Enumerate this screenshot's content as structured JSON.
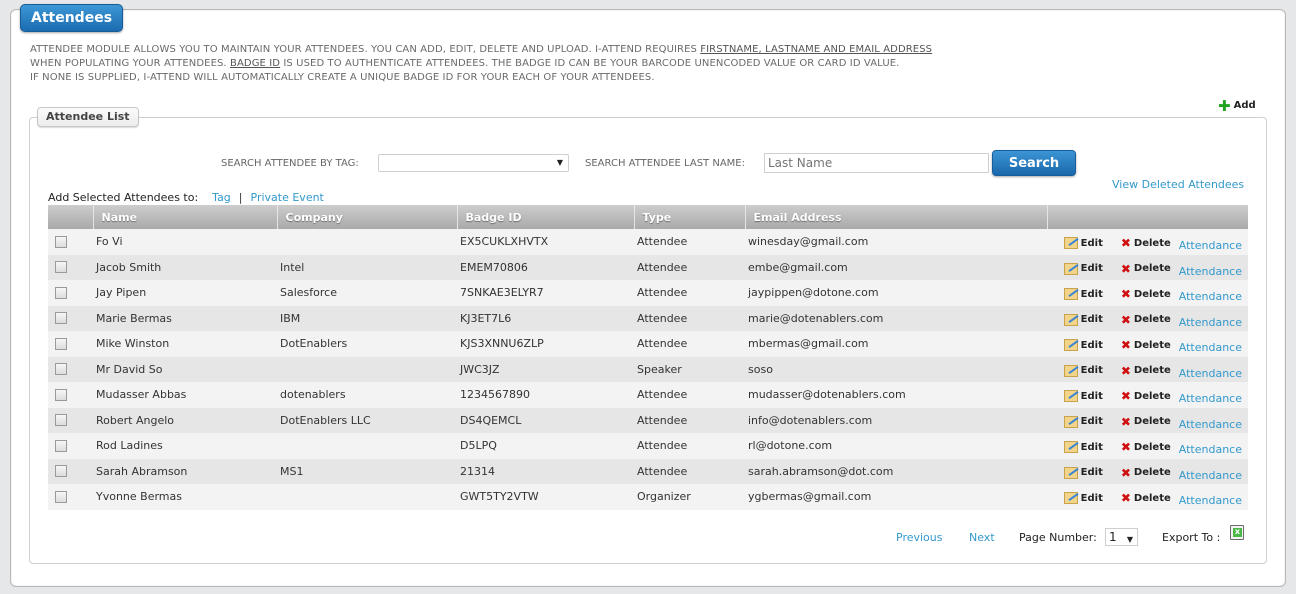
{
  "module": {
    "title": "Attendees",
    "intro_lines": [
      {
        "text": "ATTENDEE MODULE ALLOWS YOU TO MAINTAIN YOUR ATTENDEES. YOU CAN ADD, EDIT, DELETE AND UPLOAD. I-ATTEND REQUIRES ",
        "underlined": "FIRSTNAME, LASTNAME AND EMAIL ADDRESS",
        "after": ""
      },
      {
        "text": "WHEN POPULATING YOUR ATTENDEES. ",
        "underlined": "BADGE ID",
        "after": " IS USED TO AUTHENTICATE ATTENDEES. THE BADGE ID CAN BE YOUR BARCODE UNENCODED VALUE OR CARD ID VALUE."
      },
      {
        "text": "IF NONE IS SUPPLIED, I-ATTEND WILL AUTOMATICALLY CREATE A UNIQUE BADGE ID FOR YOUR EACH OF YOUR ATTENDEES.",
        "underlined": "",
        "after": ""
      }
    ],
    "add_label": "Add"
  },
  "list": {
    "title": "Attendee List",
    "search_tag_label": "SEARCH ATTENDEE BY TAG:",
    "search_tag_value": "",
    "search_lname_label": "SEARCH ATTENDEE LAST NAME:",
    "search_lname_placeholder": "Last Name",
    "search_button": "Search",
    "view_deleted": "View Deleted Attendees",
    "add_selected_label": "Add Selected Attendees to:",
    "add_selected_tag": "Tag",
    "add_selected_separator": "|",
    "add_selected_private": "Private Event",
    "columns": [
      "",
      "Name",
      "Company",
      "Badge ID",
      "Type",
      "Email Address",
      ""
    ],
    "action_labels": {
      "edit": "Edit",
      "delete": "Delete",
      "attendance": "Attendance"
    },
    "rows": [
      {
        "name": "Fo Vi",
        "company": "",
        "badge": "EX5CUKLXHVTX",
        "type": "Attendee",
        "email": "winesday@gmail.com"
      },
      {
        "name": "Jacob Smith",
        "company": "Intel",
        "badge": "EMEM70806",
        "type": "Attendee",
        "email": "embe@gmail.com"
      },
      {
        "name": "Jay Pipen",
        "company": "Salesforce",
        "badge": "7SNKAE3ELYR7",
        "type": "Attendee",
        "email": "jaypippen@dotone.com"
      },
      {
        "name": "Marie Bermas",
        "company": "IBM",
        "badge": "KJ3ET7L6",
        "type": "Attendee",
        "email": "marie@dotenablers.com"
      },
      {
        "name": "Mike Winston",
        "company": "DotEnablers",
        "badge": "KJS3XNNU6ZLP",
        "type": "Attendee",
        "email": "mbermas@gmail.com"
      },
      {
        "name": "Mr David So",
        "company": "",
        "badge": "JWC3JZ",
        "type": "Speaker",
        "email": "soso"
      },
      {
        "name": "Mudasser Abbas",
        "company": "dotenablers",
        "badge": "1234567890",
        "type": "Attendee",
        "email": "mudasser@dotenablers.com"
      },
      {
        "name": "Robert Angelo",
        "company": "DotEnablers LLC",
        "badge": "DS4QEMCL",
        "type": "Attendee",
        "email": "info@dotenablers.com"
      },
      {
        "name": "Rod Ladines",
        "company": "",
        "badge": "D5LPQ",
        "type": "Attendee",
        "email": "rl@dotone.com"
      },
      {
        "name": "Sarah Abramson",
        "company": "MS1",
        "badge": "21314",
        "type": "Attendee",
        "email": "sarah.abramson@dot.com"
      },
      {
        "name": "Yvonne Bermas",
        "company": "",
        "badge": "GWT5TY2VTW",
        "type": "Organizer",
        "email": "ygbermas@gmail.com"
      }
    ]
  },
  "pagination": {
    "previous": "Previous",
    "next": "Next",
    "page_number_label": "Page Number:",
    "page_number_value": "1",
    "export_label": "Export To :"
  },
  "colors": {
    "accent_blue": "#1b6cb0",
    "link": "#3399cc",
    "add_green": "#1ea41e",
    "delete_red": "#d01010"
  }
}
